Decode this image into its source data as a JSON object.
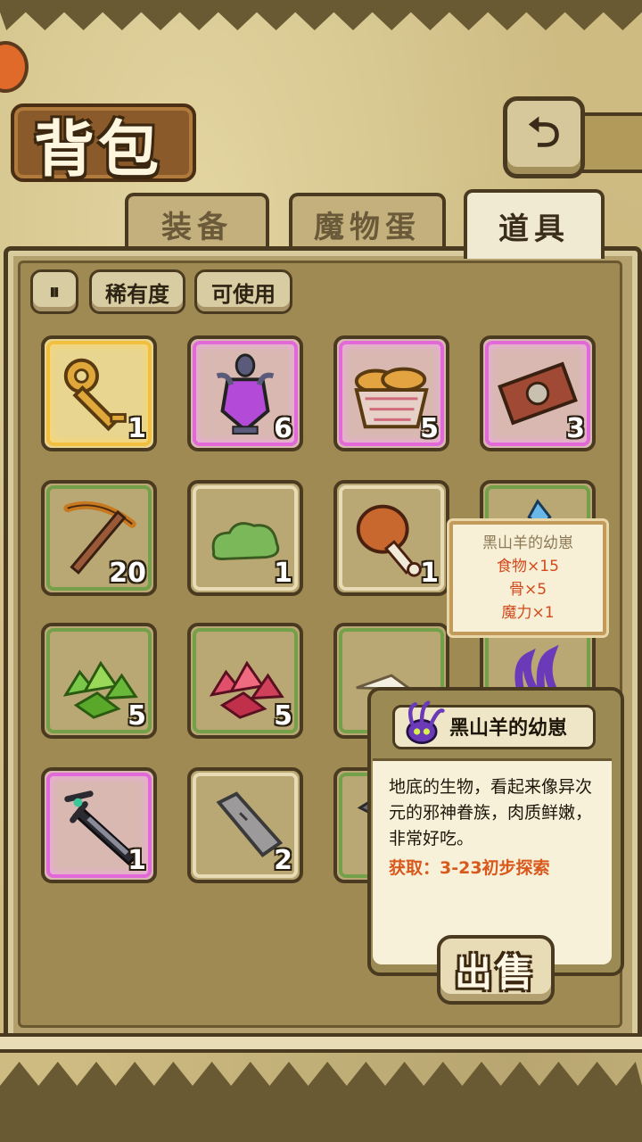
{
  "header": {
    "title": "背包",
    "back_glyph": "⮌"
  },
  "tabs": [
    {
      "label": "装备",
      "active": false
    },
    {
      "label": "魔物蛋",
      "active": false
    },
    {
      "label": "道具",
      "active": true
    }
  ],
  "filters": {
    "sort_glyph": "⏸",
    "rarity_label": "稀有度",
    "usable_label": "可使用"
  },
  "items": [
    {
      "icon": "golden-key-icon",
      "count": "1",
      "rarity": "gold"
    },
    {
      "icon": "purple-potion-vase-icon",
      "count": "6",
      "rarity": "pink"
    },
    {
      "icon": "bread-basket-icon",
      "count": "5",
      "rarity": "pink"
    },
    {
      "icon": "ticket-icon",
      "count": "3",
      "rarity": "pink"
    },
    {
      "icon": "pickaxe-icon",
      "count": "20",
      "rarity": "green"
    },
    {
      "icon": "green-slime-icon",
      "count": "1",
      "rarity": "plain"
    },
    {
      "icon": "meat-drumstick-icon",
      "count": "1",
      "rarity": "plain"
    },
    {
      "icon": "blue-crystal-icon",
      "count": "",
      "rarity": "green"
    },
    {
      "icon": "green-crystal-cluster-icon",
      "count": "5",
      "rarity": "green"
    },
    {
      "icon": "red-crystal-cluster-icon",
      "count": "5",
      "rarity": "green"
    },
    {
      "icon": "flour-pile-icon",
      "count": "",
      "rarity": "green"
    },
    {
      "icon": "purple-tentacle-icon",
      "count": "",
      "rarity": "green"
    },
    {
      "icon": "dark-sword-icon",
      "count": "1",
      "rarity": "pink"
    },
    {
      "icon": "stone-slab-icon",
      "count": "2",
      "rarity": "plain"
    },
    {
      "icon": "unknown-item-icon",
      "count": "",
      "rarity": "green"
    }
  ],
  "mini_tooltip": {
    "name": "黑山羊的幼崽",
    "lines": [
      "食物×15",
      "骨×5",
      "魔力×1"
    ]
  },
  "detail": {
    "name": "黑山羊的幼崽",
    "description": "地底的生物，看起来像异次元的邪神眷族，肉质鲜嫩，非常好吃。",
    "source": "获取：3-23初步探索",
    "sell_label": "出售"
  },
  "colors": {
    "gold": "#f2c040",
    "pink": "#e26ad8",
    "green": "#75a04a",
    "accent_text": "#d9581c"
  }
}
